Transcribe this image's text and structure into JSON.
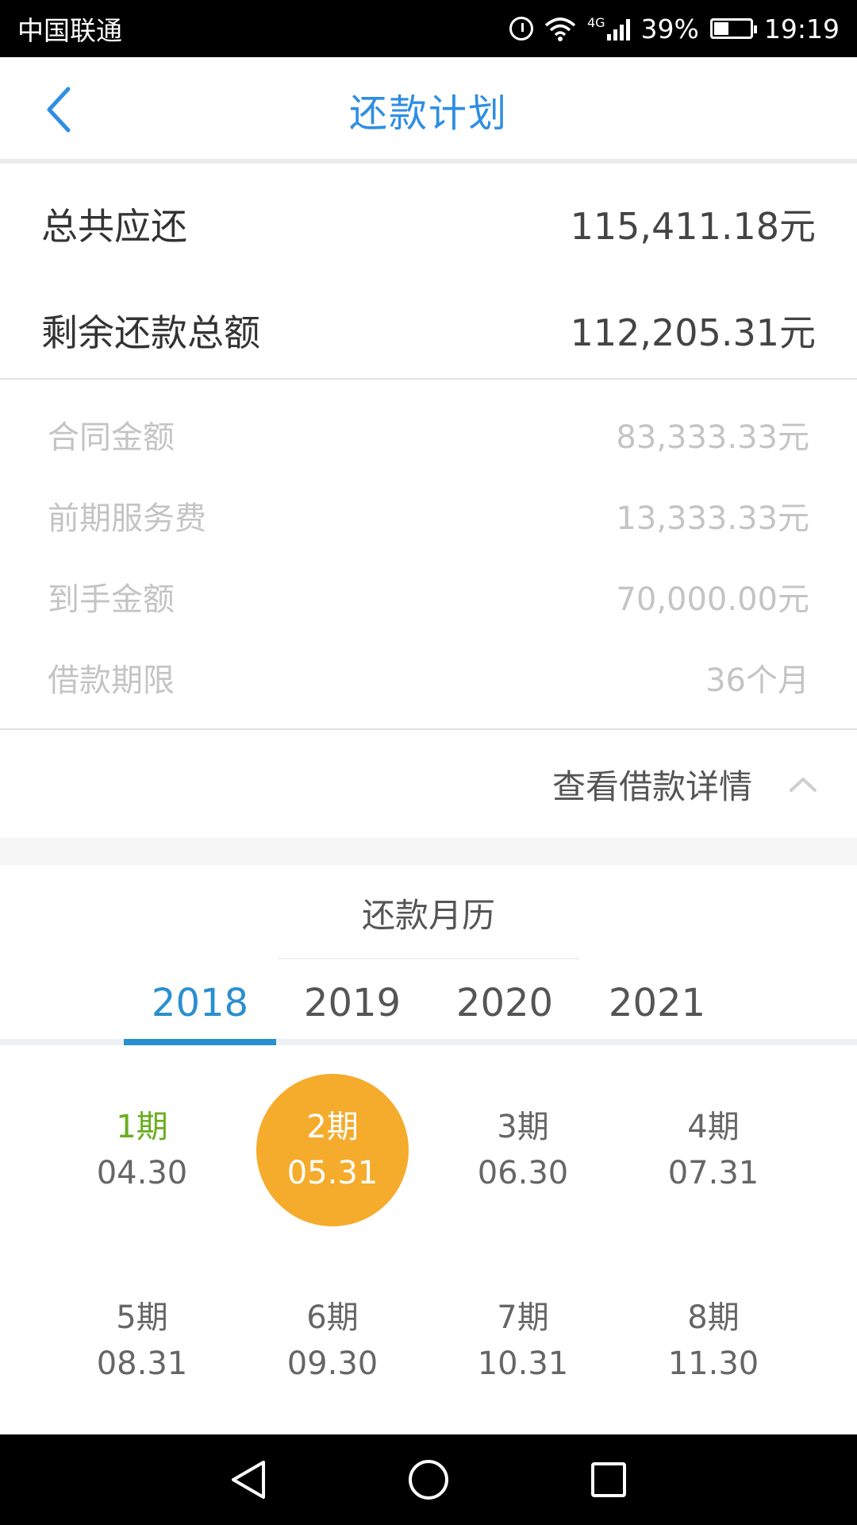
{
  "status_bar": {
    "carrier": "中国联通",
    "network": "4G",
    "battery": "39%",
    "time": "19:19"
  },
  "header": {
    "title": "还款计划"
  },
  "totals": {
    "total_due_label": "总共应还",
    "total_due_value": "115,411.18元",
    "remaining_label": "剩余还款总额",
    "remaining_value": "112,205.31元"
  },
  "details": [
    {
      "label": "合同金额",
      "value": "83,333.33元"
    },
    {
      "label": "前期服务费",
      "value": "13,333.33元"
    },
    {
      "label": "到手金额",
      "value": "70,000.00元"
    },
    {
      "label": "借款期限",
      "value": "36个月"
    }
  ],
  "toggle": {
    "label": "查看借款详情"
  },
  "calendar": {
    "title": "还款月历",
    "years": [
      "2018",
      "2019",
      "2020",
      "2021"
    ],
    "active_year": "2018",
    "periods": [
      {
        "label": "1期",
        "date": "04.30",
        "state": "done"
      },
      {
        "label": "2期",
        "date": "05.31",
        "state": "current"
      },
      {
        "label": "3期",
        "date": "06.30",
        "state": "upcoming"
      },
      {
        "label": "4期",
        "date": "07.31",
        "state": "upcoming"
      },
      {
        "label": "5期",
        "date": "08.31",
        "state": "upcoming"
      },
      {
        "label": "6期",
        "date": "09.30",
        "state": "upcoming"
      },
      {
        "label": "7期",
        "date": "10.31",
        "state": "upcoming"
      },
      {
        "label": "8期",
        "date": "11.30",
        "state": "upcoming"
      }
    ]
  },
  "colors": {
    "accent_blue": "#2f8ee2",
    "tab_blue": "#2a8fd0",
    "current_period": "#f5ab2c",
    "done_period": "#6aad1f"
  },
  "icons": {
    "back": "chevron-left-icon",
    "toggle": "chevron-up-icon",
    "nav_back": "triangle-back-icon",
    "nav_home": "circle-home-icon",
    "nav_recent": "square-recent-icon"
  }
}
